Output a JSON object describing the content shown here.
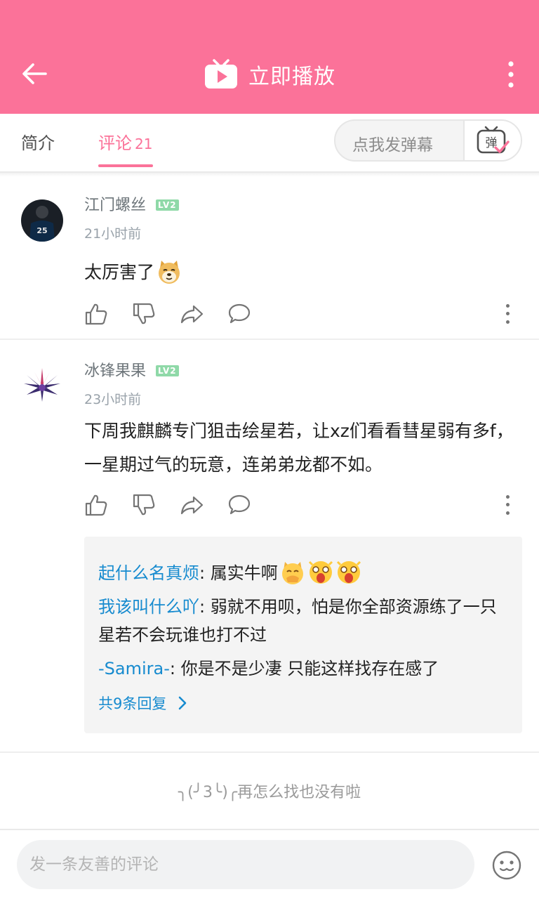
{
  "header": {
    "title": "立即播放",
    "accent": "#fb7299",
    "back_icon": "arrow-left-icon",
    "more_icon": "more-vertical-icon",
    "play_icon": "tv-play-icon"
  },
  "tabs": {
    "intro": "简介",
    "comments": "评论",
    "comments_count": "21",
    "danmaku_placeholder": "点我发弹幕",
    "danmaku_icon_glyph": "弹"
  },
  "comments": [
    {
      "username": "江门螺丝",
      "level": "LV2",
      "time": "21小时前",
      "content": "太厉害了"
    },
    {
      "username": "冰锋果果",
      "level": "LV2",
      "time": "23小时前",
      "content": "下周我麒麟专门狙击绘星若，让xz们看看彗星弱有多f，一星期过气的玩意，连弟弟龙都不如。",
      "replies": [
        {
          "name": "起什么名真烦",
          "text": ": 属实牛啊"
        },
        {
          "name": "我该叫什么吖",
          "text": ": 弱就不用呗，怕是你全部资源练了一只星若不会玩谁也打不过"
        },
        {
          "name": "-Samira-",
          "text": ": 你是不是少凄 只能这样找存在感了"
        }
      ],
      "more_replies": "共9条回复"
    }
  ],
  "footer": {
    "end_text": "╮(╯3╰)╭再怎么找也没有啦"
  },
  "bottom": {
    "input_placeholder": "发一条友善的评论",
    "emoji_icon": "smiley-icon"
  }
}
